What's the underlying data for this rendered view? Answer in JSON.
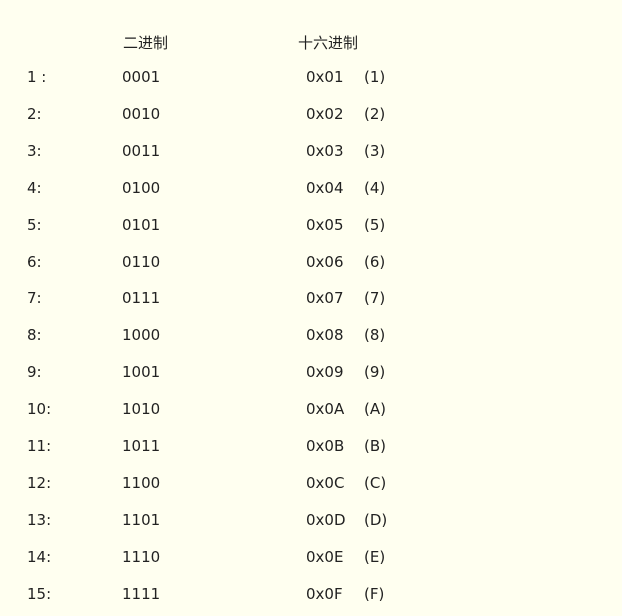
{
  "headers": {
    "binary": "二进制",
    "hex": "十六进制"
  },
  "rows": [
    {
      "index": "1 :",
      "binary": "0001",
      "hex": "0x01",
      "char": "(1)"
    },
    {
      "index": "2:",
      "binary": "0010",
      "hex": "0x02",
      "char": "(2)"
    },
    {
      "index": "3:",
      "binary": "0011",
      "hex": "0x03",
      "char": "(3)"
    },
    {
      "index": "4:",
      "binary": "0100",
      "hex": "0x04",
      "char": "(4)"
    },
    {
      "index": "5:",
      "binary": "0101",
      "hex": "0x05",
      "char": "(5)"
    },
    {
      "index": "6:",
      "binary": "0110",
      "hex": "0x06",
      "char": "(6)"
    },
    {
      "index": "7:",
      "binary": "0111",
      "hex": "0x07",
      "char": "(7)"
    },
    {
      "index": "8:",
      "binary": "1000",
      "hex": "0x08",
      "char": "(8)"
    },
    {
      "index": "9:",
      "binary": "1001",
      "hex": "0x09",
      "char": "(9)"
    },
    {
      "index": "10:",
      "binary": "1010",
      "hex": "0x0A",
      "char": "(A)"
    },
    {
      "index": "11:",
      "binary": "1011",
      "hex": "0x0B",
      "char": "(B)"
    },
    {
      "index": "12:",
      "binary": "1100",
      "hex": "0x0C",
      "char": "(C)"
    },
    {
      "index": "13:",
      "binary": "1101",
      "hex": "0x0D",
      "char": "(D)"
    },
    {
      "index": "14:",
      "binary": "1110",
      "hex": "0x0E",
      "char": "(E)"
    },
    {
      "index": "15:",
      "binary": "1111",
      "hex": "0x0F",
      "char": "(F)"
    }
  ]
}
